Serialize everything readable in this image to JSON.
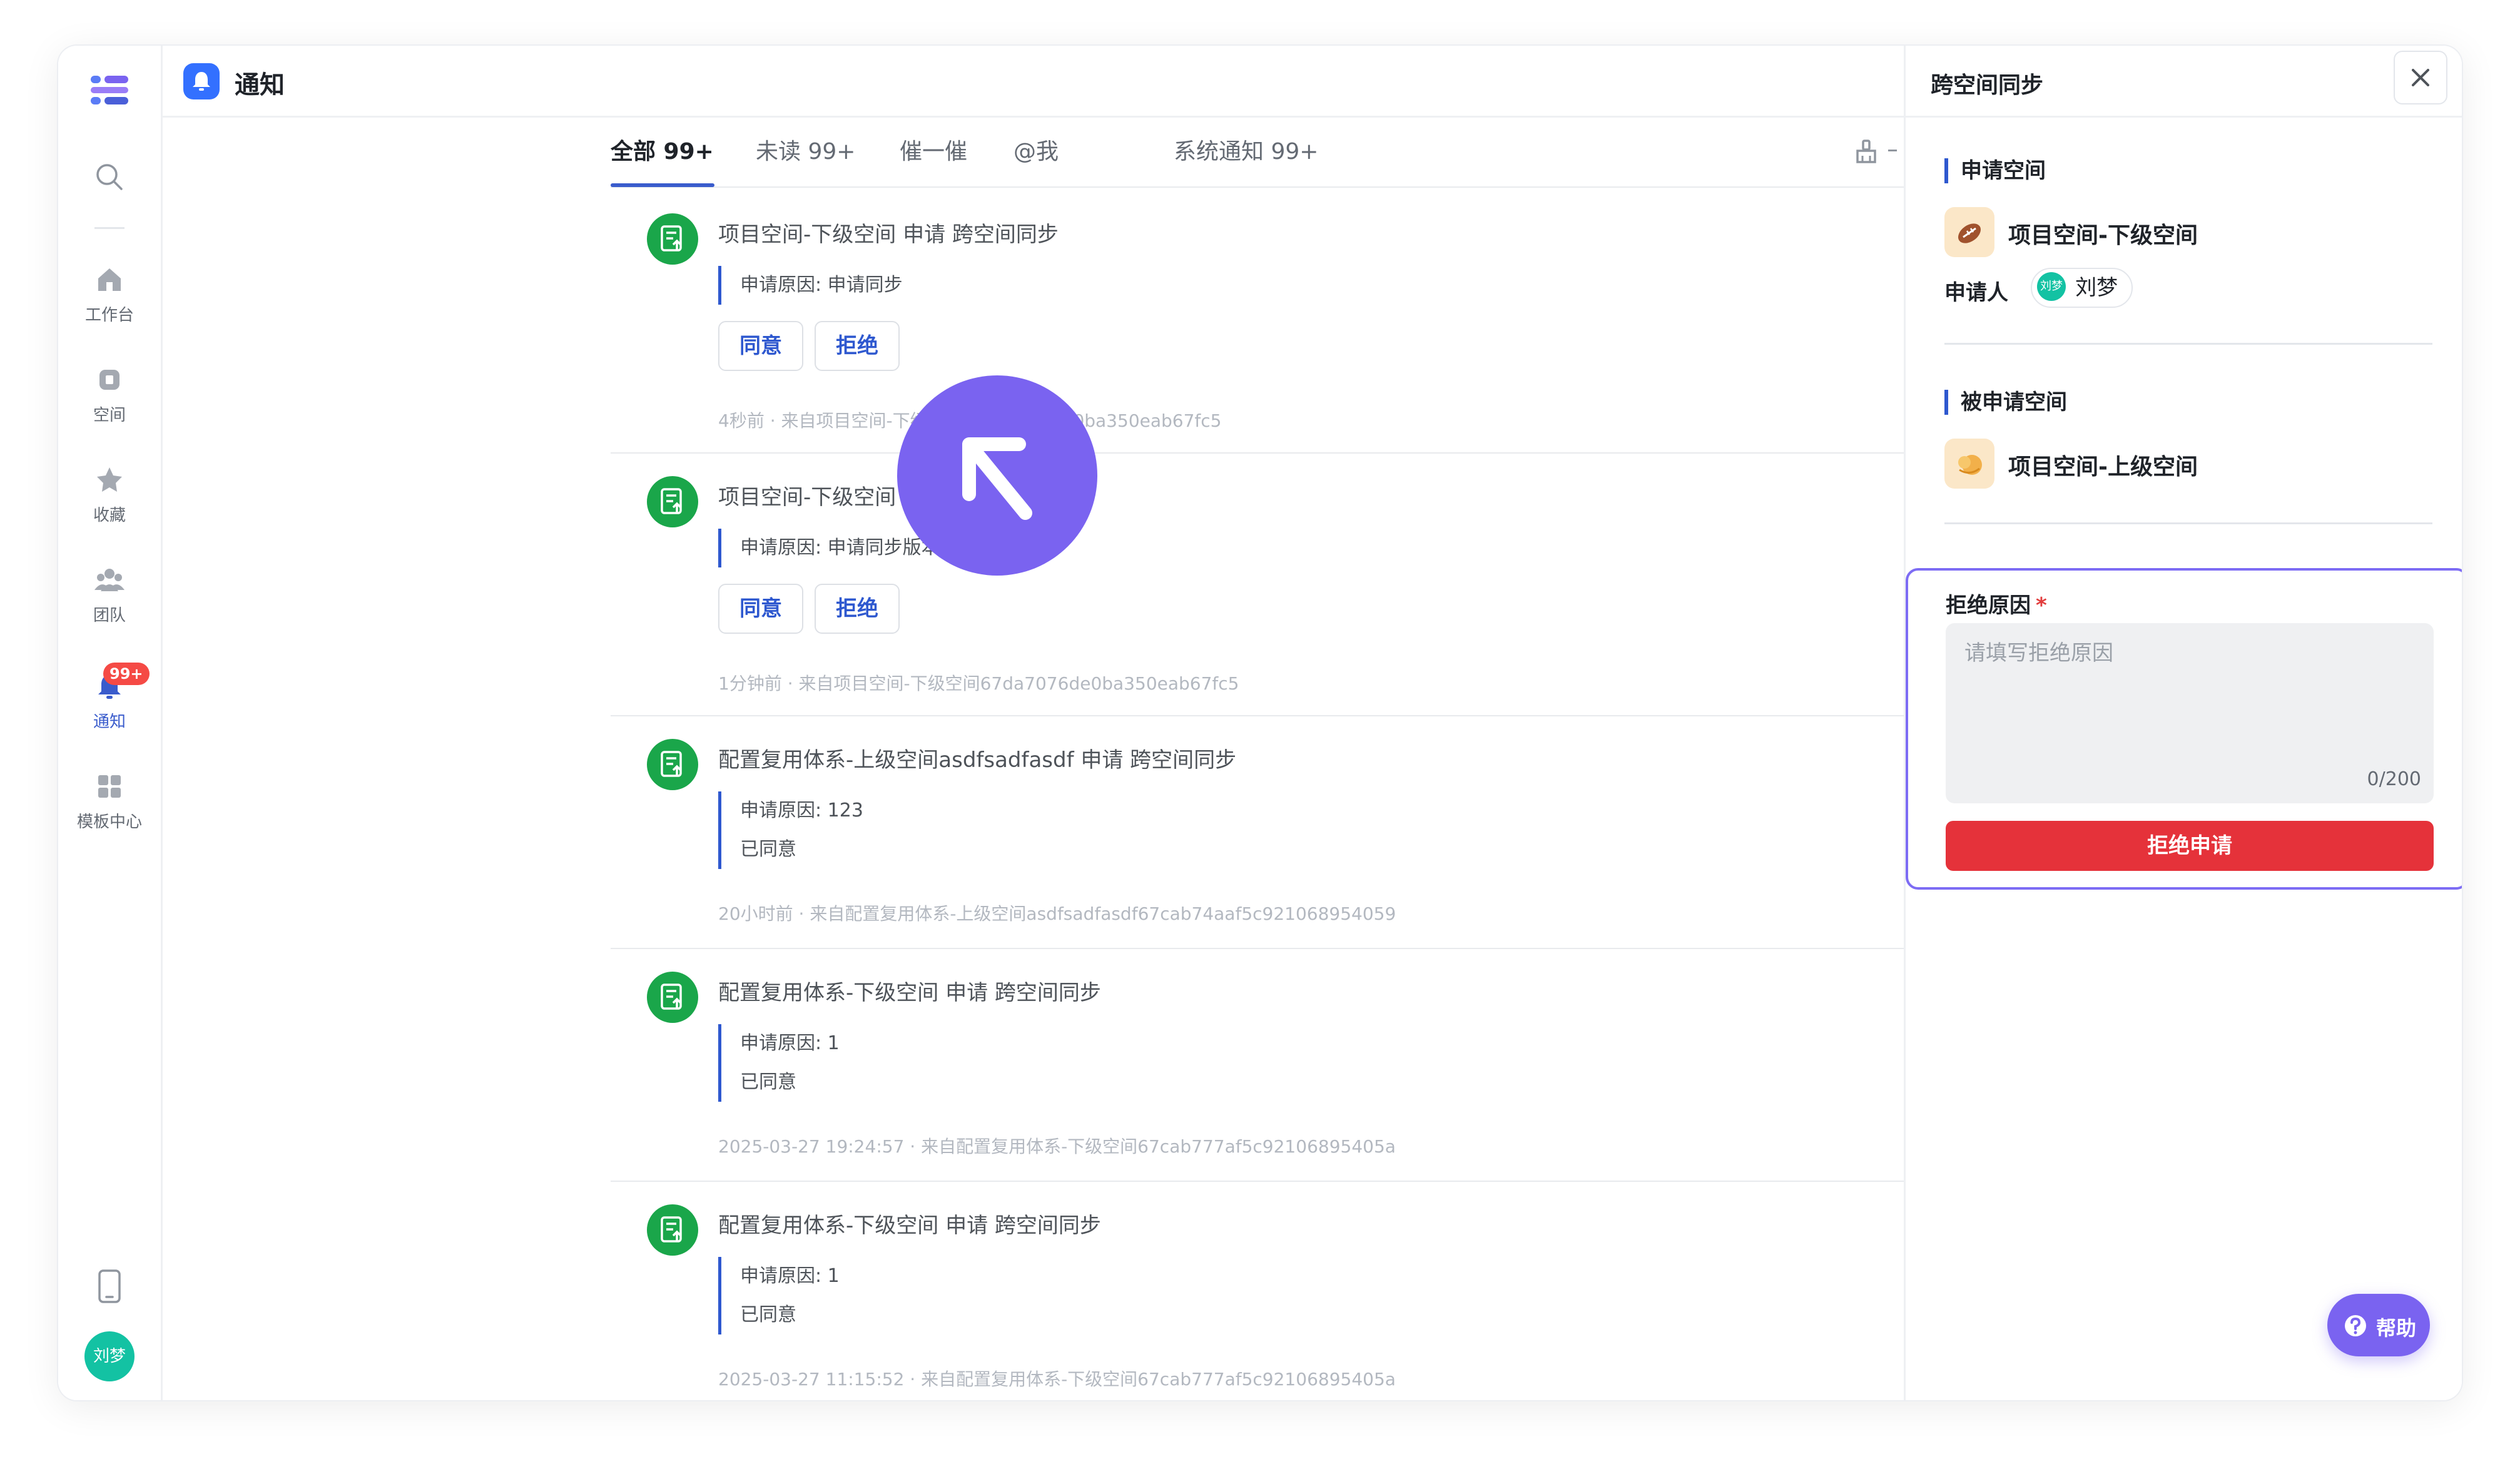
{
  "header": {
    "title": "通知"
  },
  "sidebar": {
    "items": [
      {
        "label": "工作台"
      },
      {
        "label": "空间"
      },
      {
        "label": "收藏"
      },
      {
        "label": "团队"
      },
      {
        "label": "通知",
        "badge": "99+",
        "active": true
      },
      {
        "label": "模板中心"
      }
    ],
    "user_avatar": "刘梦"
  },
  "tabs": [
    {
      "label": "全部 99+",
      "active": true
    },
    {
      "label": "未读 99+"
    },
    {
      "label": "催一催"
    },
    {
      "label": "@我"
    },
    {
      "label": "系统通知 99+"
    }
  ],
  "notifications": [
    {
      "title": "项目空间-下级空间 申请 跨空间同步",
      "reason": "申请原因: 申请同步",
      "actions": {
        "agree": "同意",
        "reject": "拒绝"
      },
      "meta": "4秒前 · 来自项目空间-下级空间67da7076de0ba350eab67fc5"
    },
    {
      "title": "项目空间-下级空间 申请 跨空间同步",
      "reason": "申请原因: 申请同步版本工作项配置",
      "actions": {
        "agree": "同意",
        "reject": "拒绝"
      },
      "meta": "1分钟前 · 来自项目空间-下级空间67da7076de0ba350eab67fc5"
    },
    {
      "title": "配置复用体系-上级空间asdfsadfasdf 申请 跨空间同步",
      "reason": "申请原因: 123",
      "status": "已同意",
      "meta": "20小时前 · 来自配置复用体系-上级空间asdfsadfasdf67cab74aaf5c921068954059"
    },
    {
      "title": "配置复用体系-下级空间 申请 跨空间同步",
      "reason": "申请原因: 1",
      "status": "已同意",
      "meta": "2025-03-27 19:24:57 · 来自配置复用体系-下级空间67cab777af5c92106895405a"
    },
    {
      "title": "配置复用体系-下级空间 申请 跨空间同步",
      "reason": "申请原因: 1",
      "status": "已同意",
      "meta": "2025-03-27 11:15:52 · 来自配置复用体系-下级空间67cab777af5c92106895405a"
    }
  ],
  "panel": {
    "title": "跨空间同步",
    "applicant_space": {
      "label": "申请空间",
      "name": "项目空间-下级空间"
    },
    "applicant": {
      "label": "申请人",
      "avatar": "刘梦",
      "name": "刘梦"
    },
    "target_space": {
      "label": "被申请空间",
      "name": "项目空间-上级空间"
    },
    "reject": {
      "label": "拒绝原因",
      "required_mark": "*",
      "placeholder": "请填写拒绝原因",
      "value": "",
      "count": "0/200",
      "submit": "拒绝申请"
    },
    "help": "帮助"
  },
  "colors": {
    "accent": "#2e58cf",
    "brand_purple": "#7a63f0",
    "success_green": "#1aa64a",
    "danger_red": "#e5323a",
    "badge_red": "#f54a45"
  },
  "icons": {
    "logo": "app-logo-icon",
    "search": "search-icon",
    "workbench": "home-icon",
    "space": "space-icon",
    "favorites": "star-icon",
    "team": "team-icon",
    "notify": "bell-icon",
    "templates": "grid-icon",
    "mobile": "phone-icon",
    "clear": "broom-icon",
    "sync_request": "document-sync-icon",
    "close": "close-icon",
    "help": "question-icon"
  }
}
